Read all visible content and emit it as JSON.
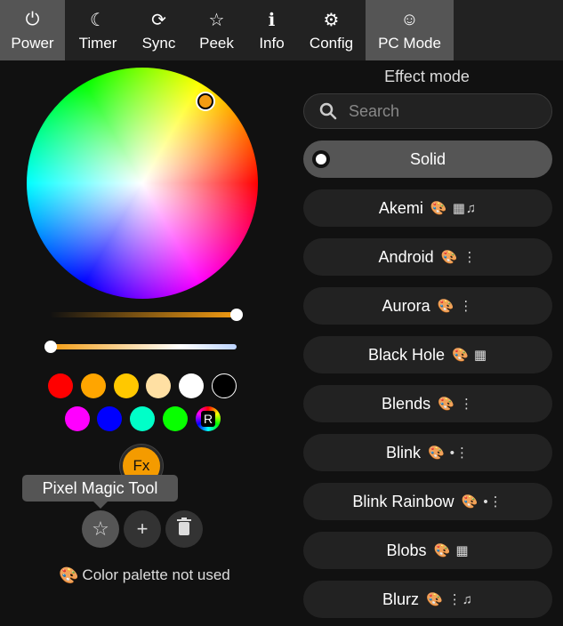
{
  "tabs": [
    {
      "label": "Power",
      "icon": "power-icon",
      "glyph": "⏻",
      "active": true
    },
    {
      "label": "Timer",
      "icon": "moon-icon",
      "glyph": "☾",
      "active": false
    },
    {
      "label": "Sync",
      "icon": "sync-icon",
      "glyph": "⟳",
      "active": false
    },
    {
      "label": "Peek",
      "icon": "star-outline-icon",
      "glyph": "☆",
      "active": false
    },
    {
      "label": "Info",
      "icon": "info-icon",
      "glyph": "ℹ",
      "active": false
    },
    {
      "label": "Config",
      "icon": "gear-icon",
      "glyph": "⚙",
      "active": false
    },
    {
      "label": "PC Mode",
      "icon": "smiley-icon",
      "glyph": "☺",
      "active": true
    }
  ],
  "color": {
    "selected_hex": "#f39c12",
    "brightness_fraction": 1.0,
    "white_fraction": 0.0
  },
  "quick_colors": {
    "row1": [
      "#ff0000",
      "#ffa500",
      "#ffc800",
      "#ffe0a3",
      "#ffffff",
      "#000000"
    ],
    "row2": [
      "#ff00ff",
      "#0000ff",
      "#00ffc8",
      "#08ff00"
    ],
    "random_label": "R"
  },
  "fx_button": {
    "label": "Fx"
  },
  "tooltip": {
    "text": "Pixel Magic Tool"
  },
  "note": {
    "text": "Color palette not used",
    "icon": "palette-icon",
    "glyph": "🎨"
  },
  "effects": {
    "title": "Effect mode",
    "search_placeholder": "Search",
    "items": [
      {
        "name": "Solid",
        "flags": "",
        "selected": true
      },
      {
        "name": "Akemi",
        "flags": "🎨 ▦♫"
      },
      {
        "name": "Android",
        "flags": "🎨 ⋮"
      },
      {
        "name": "Aurora",
        "flags": "🎨 ⋮"
      },
      {
        "name": "Black Hole",
        "flags": "🎨 ▦"
      },
      {
        "name": "Blends",
        "flags": "🎨 ⋮"
      },
      {
        "name": "Blink",
        "flags": "🎨 •⋮"
      },
      {
        "name": "Blink Rainbow",
        "flags": "🎨 •⋮"
      },
      {
        "name": "Blobs",
        "flags": "🎨 ▦"
      },
      {
        "name": "Blurz",
        "flags": "🎨 ⋮♫"
      }
    ]
  }
}
